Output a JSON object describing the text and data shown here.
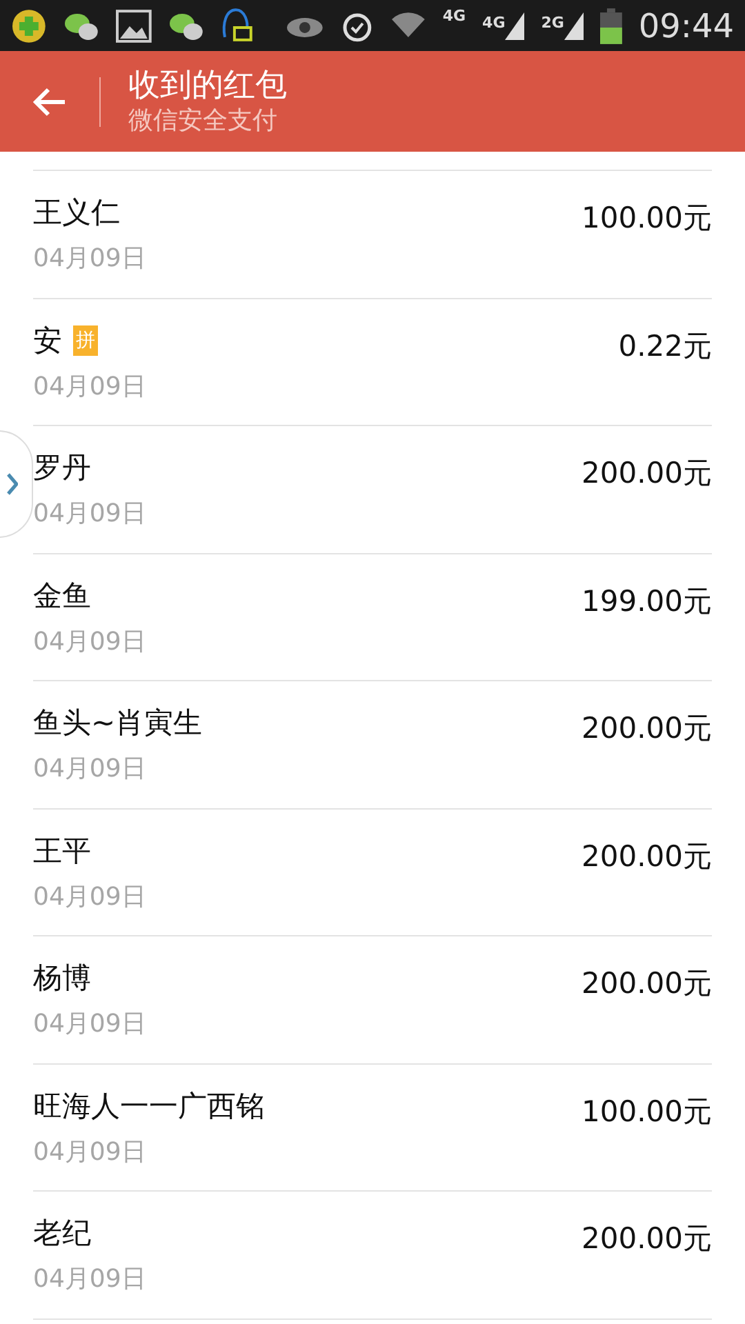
{
  "status_bar": {
    "network_labels": [
      "4G",
      "4G",
      "2G"
    ],
    "time": "09:44"
  },
  "header": {
    "title": "收到的红包",
    "subtitle": "微信安全支付"
  },
  "records": [
    {
      "name": "王义仁",
      "date": "04月09日",
      "amount": "100.00元"
    },
    {
      "name": "安",
      "badge": "拼",
      "date": "04月09日",
      "amount": "0.22元"
    },
    {
      "name": "罗丹",
      "date": "04月09日",
      "amount": "200.00元"
    },
    {
      "name": "金鱼",
      "date": "04月09日",
      "amount": "199.00元"
    },
    {
      "name": "鱼头~肖寅生",
      "date": "04月09日",
      "amount": "200.00元"
    },
    {
      "name": "王平",
      "date": "04月09日",
      "amount": "200.00元"
    },
    {
      "name": "杨博",
      "date": "04月09日",
      "amount": "200.00元"
    },
    {
      "name": "旺海人一一广西铭",
      "date": "04月09日",
      "amount": "100.00元"
    },
    {
      "name": "老纪",
      "date": "04月09日",
      "amount": "200.00元"
    }
  ]
}
